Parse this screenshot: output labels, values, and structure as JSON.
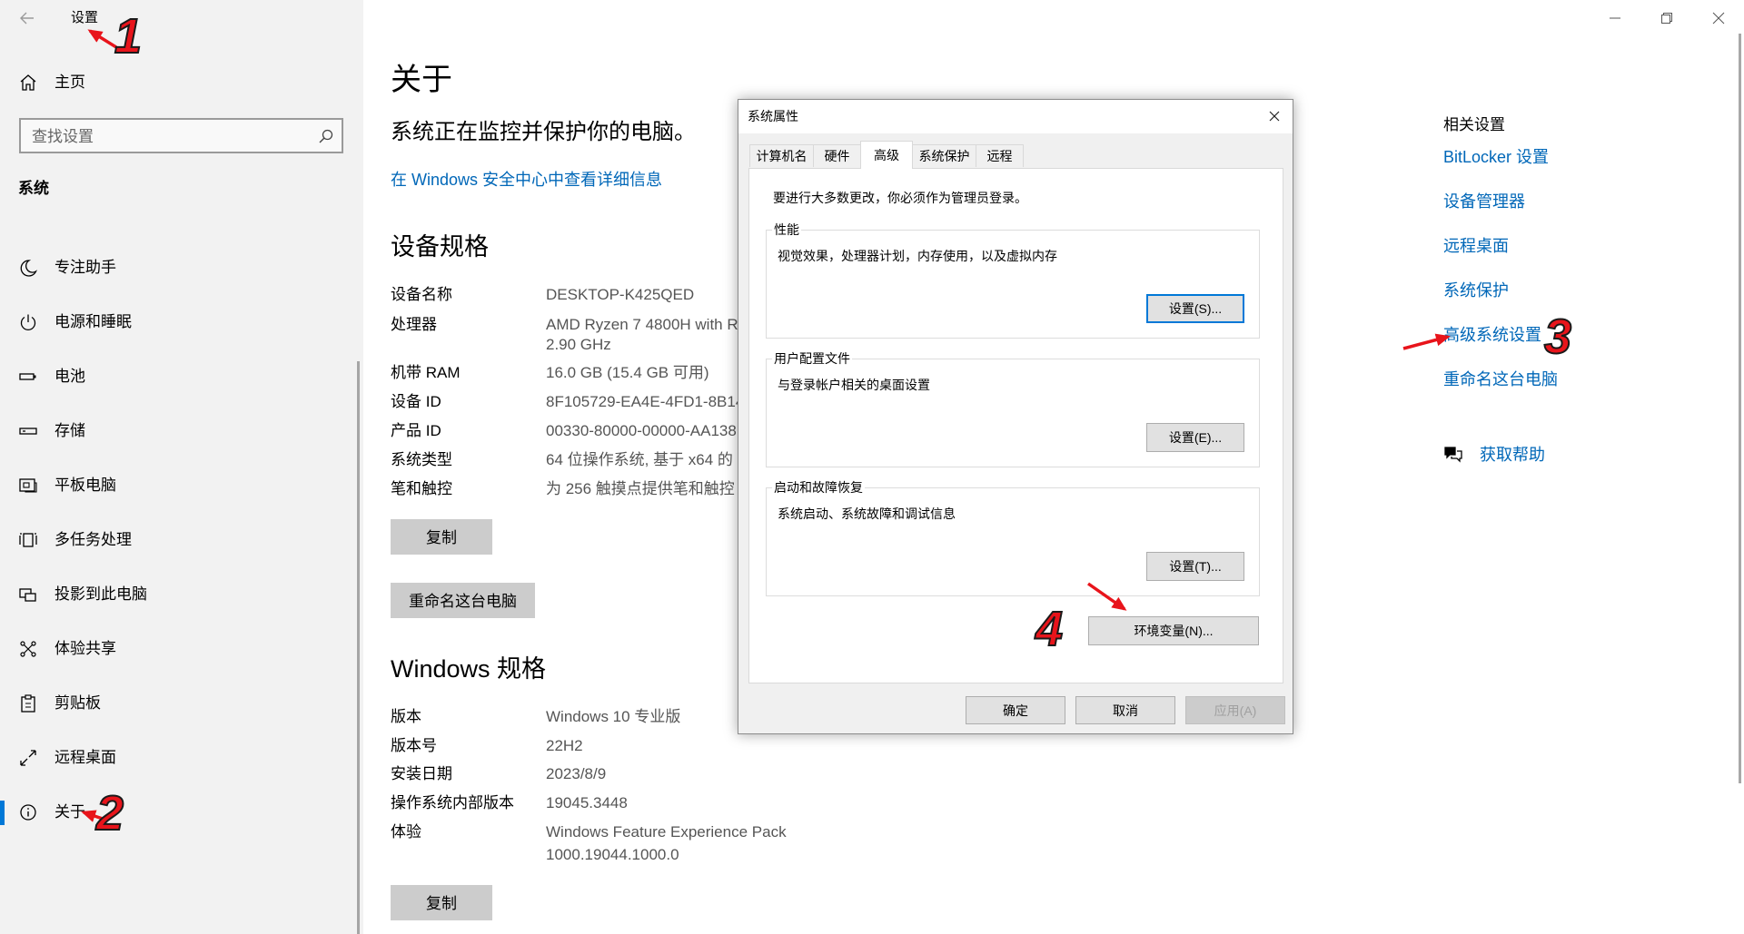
{
  "window": {
    "title": "设置"
  },
  "sidebar": {
    "home_label": "主页",
    "search_placeholder": "查找设置",
    "section_title": "系统",
    "items": [
      {
        "label": "专注助手",
        "icon": "moon-icon"
      },
      {
        "label": "电源和睡眠",
        "icon": "power-icon"
      },
      {
        "label": "电池",
        "icon": "battery-icon"
      },
      {
        "label": "存储",
        "icon": "storage-icon"
      },
      {
        "label": "平板电脑",
        "icon": "tablet-icon"
      },
      {
        "label": "多任务处理",
        "icon": "multitasking-icon"
      },
      {
        "label": "投影到此电脑",
        "icon": "projecting-icon"
      },
      {
        "label": "体验共享",
        "icon": "shared-experiences-icon"
      },
      {
        "label": "剪贴板",
        "icon": "clipboard-icon"
      },
      {
        "label": "远程桌面",
        "icon": "remote-desktop-icon"
      },
      {
        "label": "关于",
        "icon": "info-icon",
        "selected": true
      }
    ]
  },
  "main": {
    "title": "关于",
    "protection_status": "系统正在监控并保护你的电脑。",
    "security_link": "在 Windows 安全中心中查看详细信息",
    "device_specs": {
      "heading": "设备规格",
      "rows": [
        {
          "label": "设备名称",
          "value": "DESKTOP-K425QED"
        },
        {
          "label": "处理器",
          "value": "AMD Ryzen 7 4800H with R",
          "value_line2": "2.90 GHz"
        },
        {
          "label": "机带 RAM",
          "value": "16.0 GB (15.4 GB 可用)"
        },
        {
          "label": "设备 ID",
          "value": "8F105729-EA4E-4FD1-8B14-"
        },
        {
          "label": "产品 ID",
          "value": "00330-80000-00000-AA138"
        },
        {
          "label": "系统类型",
          "value": "64 位操作系统, 基于 x64 的"
        },
        {
          "label": "笔和触控",
          "value": "为 256 触摸点提供笔和触控"
        }
      ],
      "copy_button": "复制",
      "rename_button": "重命名这台电脑"
    },
    "windows_specs": {
      "heading": "Windows 规格",
      "rows": [
        {
          "label": "版本",
          "value": "Windows 10 专业版"
        },
        {
          "label": "版本号",
          "value": "22H2"
        },
        {
          "label": "安装日期",
          "value": "2023/8/9"
        },
        {
          "label": "操作系统内部版本",
          "value": "19045.3448"
        },
        {
          "label": "体验",
          "value": "Windows Feature Experience Pack",
          "value_line2": "1000.19044.1000.0"
        }
      ],
      "copy_button": "复制"
    }
  },
  "related_settings": {
    "heading": "相关设置",
    "links": [
      "BitLocker 设置",
      "设备管理器",
      "远程桌面",
      "系统保护",
      "高级系统设置",
      "重命名这台电脑"
    ],
    "help_link": "获取帮助"
  },
  "dialog": {
    "title": "系统属性",
    "tabs": [
      {
        "label": "计算机名"
      },
      {
        "label": "硬件"
      },
      {
        "label": "高级",
        "selected": true
      },
      {
        "label": "系统保护"
      },
      {
        "label": "远程"
      }
    ],
    "admin_notice": "要进行大多数更改，你必须作为管理员登录。",
    "groups": [
      {
        "title": "性能",
        "description": "视觉效果，处理器计划，内存使用，以及虚拟内存",
        "button": "设置(S)..."
      },
      {
        "title": "用户配置文件",
        "description": "与登录帐户相关的桌面设置",
        "button": "设置(E)..."
      },
      {
        "title": "启动和故障恢复",
        "description": "系统启动、系统故障和调试信息",
        "button": "设置(T)..."
      }
    ],
    "env_vars_button": "环境变量(N)...",
    "ok_button": "确定",
    "cancel_button": "取消",
    "apply_button": "应用(A)"
  },
  "annotations": {
    "step1": "1",
    "step2": "2",
    "step3": "3",
    "step4": "4"
  },
  "colors": {
    "accent": "#0078d7",
    "link": "#0067b8",
    "annotation": "#e8141b",
    "sidebar_bg": "#f2f2f2"
  }
}
